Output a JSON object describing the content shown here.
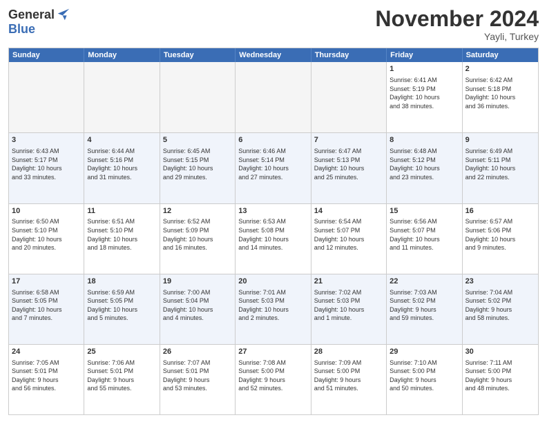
{
  "header": {
    "logo_general": "General",
    "logo_blue": "Blue",
    "month_title": "November 2024",
    "location": "Yayli, Turkey"
  },
  "weekdays": [
    "Sunday",
    "Monday",
    "Tuesday",
    "Wednesday",
    "Thursday",
    "Friday",
    "Saturday"
  ],
  "weeks": [
    [
      {
        "day": "",
        "empty": true
      },
      {
        "day": "",
        "empty": true
      },
      {
        "day": "",
        "empty": true
      },
      {
        "day": "",
        "empty": true
      },
      {
        "day": "",
        "empty": true
      },
      {
        "day": "1",
        "lines": [
          "Sunrise: 6:41 AM",
          "Sunset: 5:19 PM",
          "Daylight: 10 hours",
          "and 38 minutes."
        ]
      },
      {
        "day": "2",
        "lines": [
          "Sunrise: 6:42 AM",
          "Sunset: 5:18 PM",
          "Daylight: 10 hours",
          "and 36 minutes."
        ]
      }
    ],
    [
      {
        "day": "3",
        "lines": [
          "Sunrise: 6:43 AM",
          "Sunset: 5:17 PM",
          "Daylight: 10 hours",
          "and 33 minutes."
        ]
      },
      {
        "day": "4",
        "lines": [
          "Sunrise: 6:44 AM",
          "Sunset: 5:16 PM",
          "Daylight: 10 hours",
          "and 31 minutes."
        ]
      },
      {
        "day": "5",
        "lines": [
          "Sunrise: 6:45 AM",
          "Sunset: 5:15 PM",
          "Daylight: 10 hours",
          "and 29 minutes."
        ]
      },
      {
        "day": "6",
        "lines": [
          "Sunrise: 6:46 AM",
          "Sunset: 5:14 PM",
          "Daylight: 10 hours",
          "and 27 minutes."
        ]
      },
      {
        "day": "7",
        "lines": [
          "Sunrise: 6:47 AM",
          "Sunset: 5:13 PM",
          "Daylight: 10 hours",
          "and 25 minutes."
        ]
      },
      {
        "day": "8",
        "lines": [
          "Sunrise: 6:48 AM",
          "Sunset: 5:12 PM",
          "Daylight: 10 hours",
          "and 23 minutes."
        ]
      },
      {
        "day": "9",
        "lines": [
          "Sunrise: 6:49 AM",
          "Sunset: 5:11 PM",
          "Daylight: 10 hours",
          "and 22 minutes."
        ]
      }
    ],
    [
      {
        "day": "10",
        "lines": [
          "Sunrise: 6:50 AM",
          "Sunset: 5:10 PM",
          "Daylight: 10 hours",
          "and 20 minutes."
        ]
      },
      {
        "day": "11",
        "lines": [
          "Sunrise: 6:51 AM",
          "Sunset: 5:10 PM",
          "Daylight: 10 hours",
          "and 18 minutes."
        ]
      },
      {
        "day": "12",
        "lines": [
          "Sunrise: 6:52 AM",
          "Sunset: 5:09 PM",
          "Daylight: 10 hours",
          "and 16 minutes."
        ]
      },
      {
        "day": "13",
        "lines": [
          "Sunrise: 6:53 AM",
          "Sunset: 5:08 PM",
          "Daylight: 10 hours",
          "and 14 minutes."
        ]
      },
      {
        "day": "14",
        "lines": [
          "Sunrise: 6:54 AM",
          "Sunset: 5:07 PM",
          "Daylight: 10 hours",
          "and 12 minutes."
        ]
      },
      {
        "day": "15",
        "lines": [
          "Sunrise: 6:56 AM",
          "Sunset: 5:07 PM",
          "Daylight: 10 hours",
          "and 11 minutes."
        ]
      },
      {
        "day": "16",
        "lines": [
          "Sunrise: 6:57 AM",
          "Sunset: 5:06 PM",
          "Daylight: 10 hours",
          "and 9 minutes."
        ]
      }
    ],
    [
      {
        "day": "17",
        "lines": [
          "Sunrise: 6:58 AM",
          "Sunset: 5:05 PM",
          "Daylight: 10 hours",
          "and 7 minutes."
        ]
      },
      {
        "day": "18",
        "lines": [
          "Sunrise: 6:59 AM",
          "Sunset: 5:05 PM",
          "Daylight: 10 hours",
          "and 5 minutes."
        ]
      },
      {
        "day": "19",
        "lines": [
          "Sunrise: 7:00 AM",
          "Sunset: 5:04 PM",
          "Daylight: 10 hours",
          "and 4 minutes."
        ]
      },
      {
        "day": "20",
        "lines": [
          "Sunrise: 7:01 AM",
          "Sunset: 5:03 PM",
          "Daylight: 10 hours",
          "and 2 minutes."
        ]
      },
      {
        "day": "21",
        "lines": [
          "Sunrise: 7:02 AM",
          "Sunset: 5:03 PM",
          "Daylight: 10 hours",
          "and 1 minute."
        ]
      },
      {
        "day": "22",
        "lines": [
          "Sunrise: 7:03 AM",
          "Sunset: 5:02 PM",
          "Daylight: 9 hours",
          "and 59 minutes."
        ]
      },
      {
        "day": "23",
        "lines": [
          "Sunrise: 7:04 AM",
          "Sunset: 5:02 PM",
          "Daylight: 9 hours",
          "and 58 minutes."
        ]
      }
    ],
    [
      {
        "day": "24",
        "lines": [
          "Sunrise: 7:05 AM",
          "Sunset: 5:01 PM",
          "Daylight: 9 hours",
          "and 56 minutes."
        ]
      },
      {
        "day": "25",
        "lines": [
          "Sunrise: 7:06 AM",
          "Sunset: 5:01 PM",
          "Daylight: 9 hours",
          "and 55 minutes."
        ]
      },
      {
        "day": "26",
        "lines": [
          "Sunrise: 7:07 AM",
          "Sunset: 5:01 PM",
          "Daylight: 9 hours",
          "and 53 minutes."
        ]
      },
      {
        "day": "27",
        "lines": [
          "Sunrise: 7:08 AM",
          "Sunset: 5:00 PM",
          "Daylight: 9 hours",
          "and 52 minutes."
        ]
      },
      {
        "day": "28",
        "lines": [
          "Sunrise: 7:09 AM",
          "Sunset: 5:00 PM",
          "Daylight: 9 hours",
          "and 51 minutes."
        ]
      },
      {
        "day": "29",
        "lines": [
          "Sunrise: 7:10 AM",
          "Sunset: 5:00 PM",
          "Daylight: 9 hours",
          "and 50 minutes."
        ]
      },
      {
        "day": "30",
        "lines": [
          "Sunrise: 7:11 AM",
          "Sunset: 5:00 PM",
          "Daylight: 9 hours",
          "and 48 minutes."
        ]
      }
    ]
  ]
}
